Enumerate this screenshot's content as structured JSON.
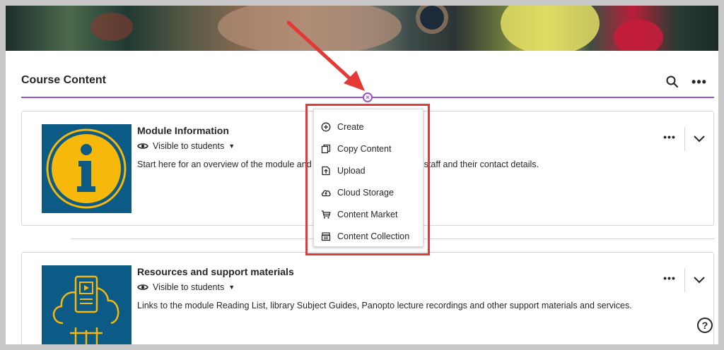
{
  "page": {
    "title": "Course Content"
  },
  "header": {
    "search_icon": "search-icon",
    "more_icon": "more-options-icon",
    "add_icon": "add-content-icon"
  },
  "menu": {
    "items": [
      {
        "label": "Create",
        "icon": "plus-circle-icon"
      },
      {
        "label": "Copy Content",
        "icon": "copy-icon"
      },
      {
        "label": "Upload",
        "icon": "upload-icon"
      },
      {
        "label": "Cloud Storage",
        "icon": "cloud-upload-icon"
      },
      {
        "label": "Content Market",
        "icon": "cart-icon"
      },
      {
        "label": "Content Collection",
        "icon": "collection-icon"
      }
    ]
  },
  "cards": [
    {
      "title": "Module Information",
      "visibility": "Visible to students",
      "description": "Start here for an overview of the module and",
      "description_tail": "staff and their contact details.",
      "icon": "info-icon"
    },
    {
      "title": "Resources and support materials",
      "visibility": "Visible to students",
      "description": "Links to the module Reading List, library Subject Guides, Panopto lecture recordings and other support materials and services.",
      "icon": "cloud-video-icon"
    }
  ],
  "help": {
    "label": "?"
  },
  "colors": {
    "accent": "#9b51c9",
    "highlight": "#e03a3a",
    "thumb": "#0b5b86",
    "thumb_icon": "#f5b80b"
  }
}
